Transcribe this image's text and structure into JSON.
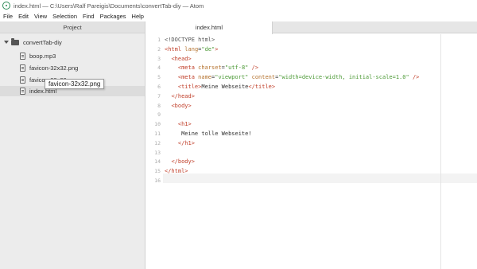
{
  "window": {
    "title": "index.html — C:\\Users\\Ralf Pareigis\\Documents\\convertTab-diy — Atom"
  },
  "menu": [
    "File",
    "Edit",
    "View",
    "Selection",
    "Find",
    "Packages",
    "Help"
  ],
  "tree": {
    "header": "Project",
    "root": "convertTab-diy",
    "files": [
      {
        "name": "boop.mp3"
      },
      {
        "name": "favicon-32x32.png"
      },
      {
        "name": "favicon-32x32.png"
      },
      {
        "name": "index.html"
      }
    ]
  },
  "tooltip": "favicon-32x32.png",
  "tab": {
    "label": "index.html"
  },
  "editor": {
    "lines": [
      {
        "n": "1",
        "parts": [
          {
            "c": "t-doc",
            "t": "<!DOCTYPE html>"
          }
        ]
      },
      {
        "n": "2",
        "parts": [
          {
            "c": "t-tag",
            "t": "<html"
          },
          {
            "c": "",
            "t": " "
          },
          {
            "c": "t-attr",
            "t": "lang"
          },
          {
            "c": "",
            "t": "="
          },
          {
            "c": "t-str",
            "t": "\"de\""
          },
          {
            "c": "t-tag",
            "t": ">"
          }
        ]
      },
      {
        "n": "3",
        "parts": [
          {
            "c": "",
            "t": "  "
          },
          {
            "c": "t-tag",
            "t": "<head>"
          }
        ]
      },
      {
        "n": "4",
        "parts": [
          {
            "c": "",
            "t": "    "
          },
          {
            "c": "t-tag",
            "t": "<meta"
          },
          {
            "c": "",
            "t": " "
          },
          {
            "c": "t-attr",
            "t": "charset"
          },
          {
            "c": "",
            "t": "="
          },
          {
            "c": "t-str",
            "t": "\"utf-8\""
          },
          {
            "c": "",
            "t": " "
          },
          {
            "c": "t-tag",
            "t": "/>"
          }
        ]
      },
      {
        "n": "5",
        "parts": [
          {
            "c": "",
            "t": "    "
          },
          {
            "c": "t-tag",
            "t": "<meta"
          },
          {
            "c": "",
            "t": " "
          },
          {
            "c": "t-attr",
            "t": "name"
          },
          {
            "c": "",
            "t": "="
          },
          {
            "c": "t-str",
            "t": "\"viewport\""
          },
          {
            "c": "",
            "t": " "
          },
          {
            "c": "t-attr",
            "t": "content"
          },
          {
            "c": "",
            "t": "="
          },
          {
            "c": "t-str",
            "t": "\"width=device-width, initial-scale=1.0\""
          },
          {
            "c": "",
            "t": " "
          },
          {
            "c": "t-tag",
            "t": "/>"
          }
        ]
      },
      {
        "n": "6",
        "parts": [
          {
            "c": "",
            "t": "    "
          },
          {
            "c": "t-tag",
            "t": "<title>"
          },
          {
            "c": "",
            "t": "Meine Webseite"
          },
          {
            "c": "t-tag",
            "t": "</title>"
          }
        ]
      },
      {
        "n": "7",
        "parts": [
          {
            "c": "",
            "t": "  "
          },
          {
            "c": "t-tag",
            "t": "</head>"
          }
        ]
      },
      {
        "n": "8",
        "parts": [
          {
            "c": "",
            "t": "  "
          },
          {
            "c": "t-tag",
            "t": "<body>"
          }
        ]
      },
      {
        "n": "9",
        "parts": []
      },
      {
        "n": "10",
        "parts": [
          {
            "c": "",
            "t": "    "
          },
          {
            "c": "t-tag",
            "t": "<h1>"
          }
        ]
      },
      {
        "n": "11",
        "parts": [
          {
            "c": "",
            "t": "     Meine tolle Webseite!"
          }
        ]
      },
      {
        "n": "12",
        "parts": [
          {
            "c": "",
            "t": "    "
          },
          {
            "c": "t-tag",
            "t": "</h1>"
          }
        ]
      },
      {
        "n": "13",
        "parts": []
      },
      {
        "n": "14",
        "parts": [
          {
            "c": "",
            "t": "  "
          },
          {
            "c": "t-tag",
            "t": "</body>"
          }
        ]
      },
      {
        "n": "15",
        "parts": [
          {
            "c": "t-tag",
            "t": "</html>"
          }
        ]
      },
      {
        "n": "16",
        "parts": []
      }
    ]
  },
  "colors": {
    "tag": "#c1402b",
    "attr": "#b5732f",
    "string": "#4c9a36",
    "accent": "#2e8b57"
  }
}
